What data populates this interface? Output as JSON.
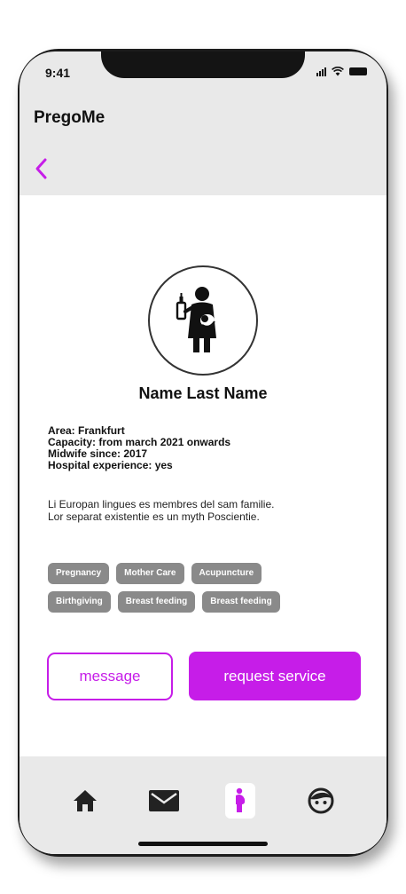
{
  "status_bar": {
    "time": "9:41"
  },
  "app": {
    "title": "PregoMe"
  },
  "profile": {
    "name": "Name Last Name",
    "info": [
      "Area: Frankfurt",
      "Capacity: from march 2021 onwards",
      "Midwife since: 2017",
      "Hospital experience: yes"
    ],
    "description": "Li Europan lingues es membres del sam familie. Lor separat existentie es un myth Poscientie.",
    "tags": [
      [
        "Pregnancy",
        "Mother Care",
        "Acupuncture"
      ],
      [
        "Birthgiving",
        "Breast feeding",
        "Breast feeding"
      ]
    ]
  },
  "actions": {
    "message_label": "message",
    "request_label": "request service"
  },
  "colors": {
    "accent": "#c61de8",
    "tag_bg": "#8a8a8a",
    "bar_bg": "#e9e9e9"
  },
  "nav": {
    "items": [
      {
        "icon": "home-icon",
        "active": false
      },
      {
        "icon": "mail-icon",
        "active": false
      },
      {
        "icon": "pregnant-woman-icon",
        "active": true
      },
      {
        "icon": "face-icon",
        "active": false
      }
    ]
  }
}
